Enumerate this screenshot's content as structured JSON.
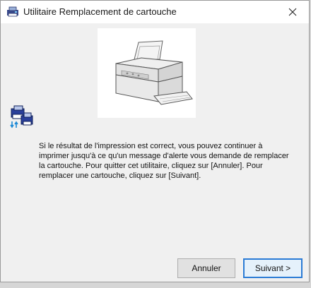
{
  "window": {
    "title": "Utilitaire Remplacement de cartouche",
    "message": "Si le résultat de l'impression est correct, vous pouvez continuer à imprimer jusqu'à ce qu'un message d'alerte vous demande de remplacer la cartouche. Pour quitter cet utilitaire, cliquez sur [Annuler]. Pour remplacer une cartouche, cliquez sur [Suivant].",
    "buttons": {
      "cancel": "Annuler",
      "next": "Suivant >"
    }
  },
  "icons": {
    "app": "printer-cartridge-icon",
    "close": "close-icon",
    "side": "cartridge-swap-icon",
    "illustration": "printer-illustration"
  },
  "colors": {
    "accent": "#2b7bd5",
    "window_bg": "#f0f0f0",
    "titlebar_bg": "#ffffff"
  }
}
